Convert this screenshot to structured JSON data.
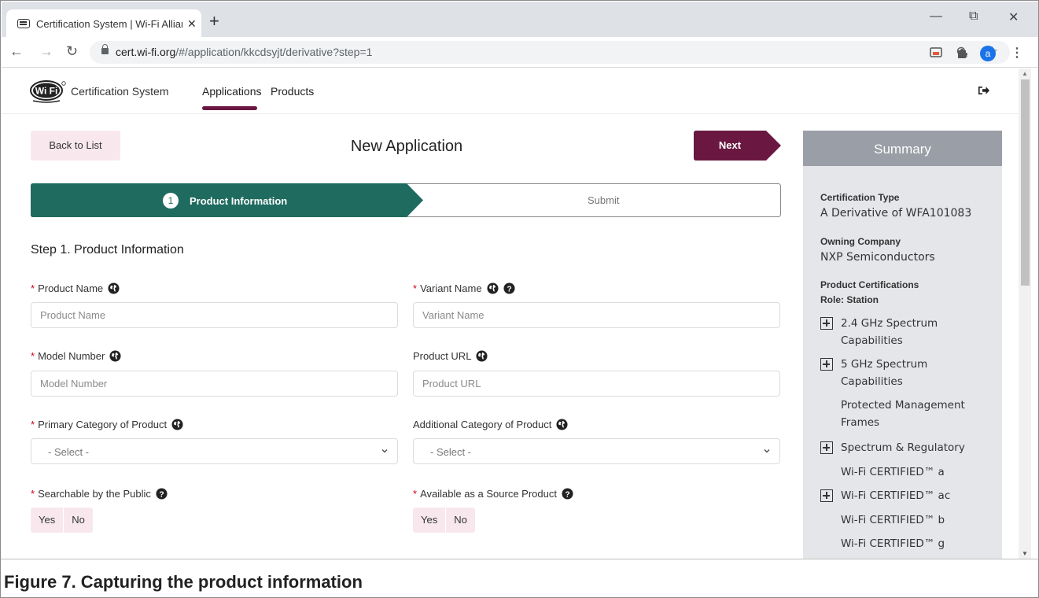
{
  "browser": {
    "tab_title": "Certification System | Wi-Fi Allian",
    "tab_close": "✕",
    "new_tab": "+",
    "url_domain": "cert.wi-fi.org",
    "url_path": "/#/application/kkcdsyjt/derivative?step=1",
    "avatar_letter": "a",
    "win_minimize": "—",
    "win_restore": "⧉",
    "win_close": "✕",
    "icons": [
      "back-arrow",
      "forward-arrow",
      "reload",
      "lock",
      "zoom",
      "star",
      "cast",
      "extensions",
      "avatar",
      "menu"
    ]
  },
  "header": {
    "brand": "Certification System",
    "nav": [
      "Applications",
      "Products"
    ],
    "active_nav": "Applications"
  },
  "page": {
    "back_label": "Back to List",
    "title": "New Application",
    "next_label": "Next",
    "steps": [
      {
        "number": "1",
        "label": "Product Information"
      },
      {
        "label": "Submit"
      }
    ],
    "section_title": "Step 1. Product Information"
  },
  "form": {
    "required_mark": "*",
    "product_name": {
      "label": "Product Name",
      "placeholder": "Product Name"
    },
    "variant_name": {
      "label": "Variant Name",
      "placeholder": "Variant Name"
    },
    "model_number": {
      "label": "Model Number",
      "placeholder": "Model Number"
    },
    "product_url": {
      "label": "Product URL",
      "placeholder": "Product URL"
    },
    "primary_category": {
      "label": "Primary Category of Product",
      "value": "- Select -"
    },
    "additional_category": {
      "label": "Additional Category of Product",
      "value": "- Select -"
    },
    "searchable": {
      "label": "Searchable by the Public",
      "yes": "Yes",
      "no": "No"
    },
    "source_product": {
      "label": "Available as a Source Product",
      "yes": "Yes",
      "no": "No"
    }
  },
  "summary": {
    "title": "Summary",
    "cert_type_label": "Certification Type",
    "cert_type_value": "A Derivative of WFA101083",
    "company_label": "Owning Company",
    "company_value": "NXP Semiconductors",
    "certs_label": "Product Certifications",
    "role_label": "Role: Station",
    "items": [
      {
        "text": "2.4 GHz Spectrum Capabilities",
        "expandable": true
      },
      {
        "text": "5 GHz Spectrum Capabilities",
        "expandable": true
      },
      {
        "text": "Protected Management Frames",
        "expandable": false
      },
      {
        "text": "Spectrum & Regulatory",
        "expandable": true
      },
      {
        "text": "Wi-Fi CERTIFIED™ a",
        "expandable": false
      },
      {
        "text": "Wi-Fi CERTIFIED™ ac",
        "expandable": true
      },
      {
        "text": "Wi-Fi CERTIFIED™ b",
        "expandable": false
      },
      {
        "text": "Wi-Fi CERTIFIED™ g",
        "expandable": false
      }
    ]
  },
  "caption": "Figure 7.  Capturing the product information",
  "colors": {
    "accent": "#6a1841",
    "stepper": "#1f6b5f",
    "pink_button": "#f8e8ee",
    "summary_header": "#9a9ea6",
    "summary_bg": "#e5e6ea",
    "required": "#d0021b"
  }
}
